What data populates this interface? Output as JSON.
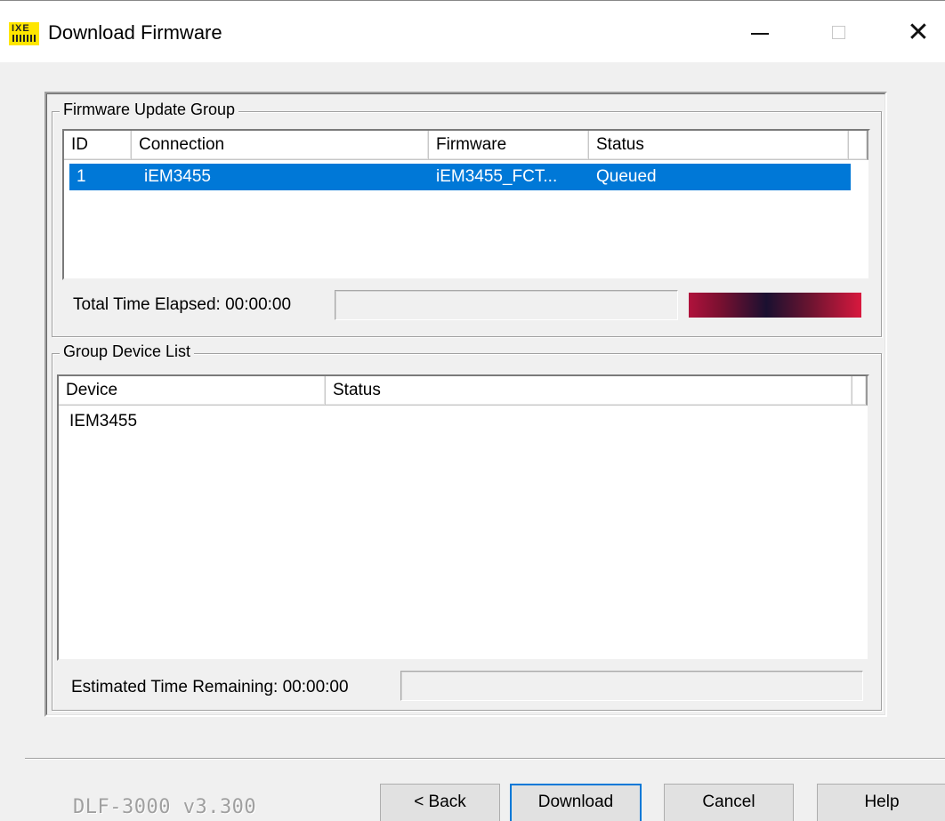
{
  "window": {
    "title": "Download Firmware",
    "icon": "app-logo-icon",
    "icon_glyph": "IXE",
    "controls": [
      "minimize-icon",
      "maximize-icon",
      "close-icon"
    ],
    "close_glyph": "✕"
  },
  "firmware_group": {
    "legend": "Firmware Update Group",
    "columns": [
      "ID",
      "Connection",
      "Firmware",
      "Status"
    ],
    "rows": [
      {
        "id": "1",
        "connection": "iEM3455",
        "firmware": "iEM3455_FCT...",
        "status": "Queued",
        "selected": true
      }
    ],
    "elapsed_label": "Total Time Elapsed: 00:00:00"
  },
  "device_group": {
    "legend": "Group Device List",
    "columns": [
      "Device",
      "Status"
    ],
    "rows": [
      {
        "device": "IEM3455",
        "status": ""
      }
    ],
    "remaining_label": "Estimated Time Remaining: 00:00:00"
  },
  "footer": {
    "version": "DLF-3000 v3.300",
    "buttons": {
      "back": "< Back",
      "download": "Download",
      "cancel": "Cancel",
      "help": "Help"
    }
  },
  "colors": {
    "selection": "#0078d7",
    "app_icon": "#ffe600"
  }
}
